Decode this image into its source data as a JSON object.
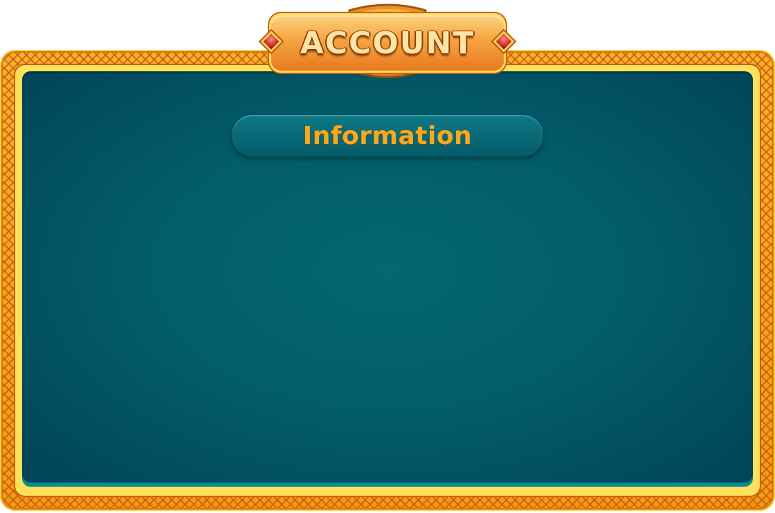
{
  "screen": {
    "title": "ACCOUNT",
    "section": "Information"
  },
  "colors": {
    "frame_gold": "#f6a41c",
    "frame_pattern": "#c4540a",
    "panel_teal": "#035d6a",
    "label_orange": "#fba81c",
    "gem_red": "#d32f2f"
  },
  "icons": {
    "left_gem": "ruby-gem-icon",
    "right_gem": "ruby-gem-icon"
  }
}
